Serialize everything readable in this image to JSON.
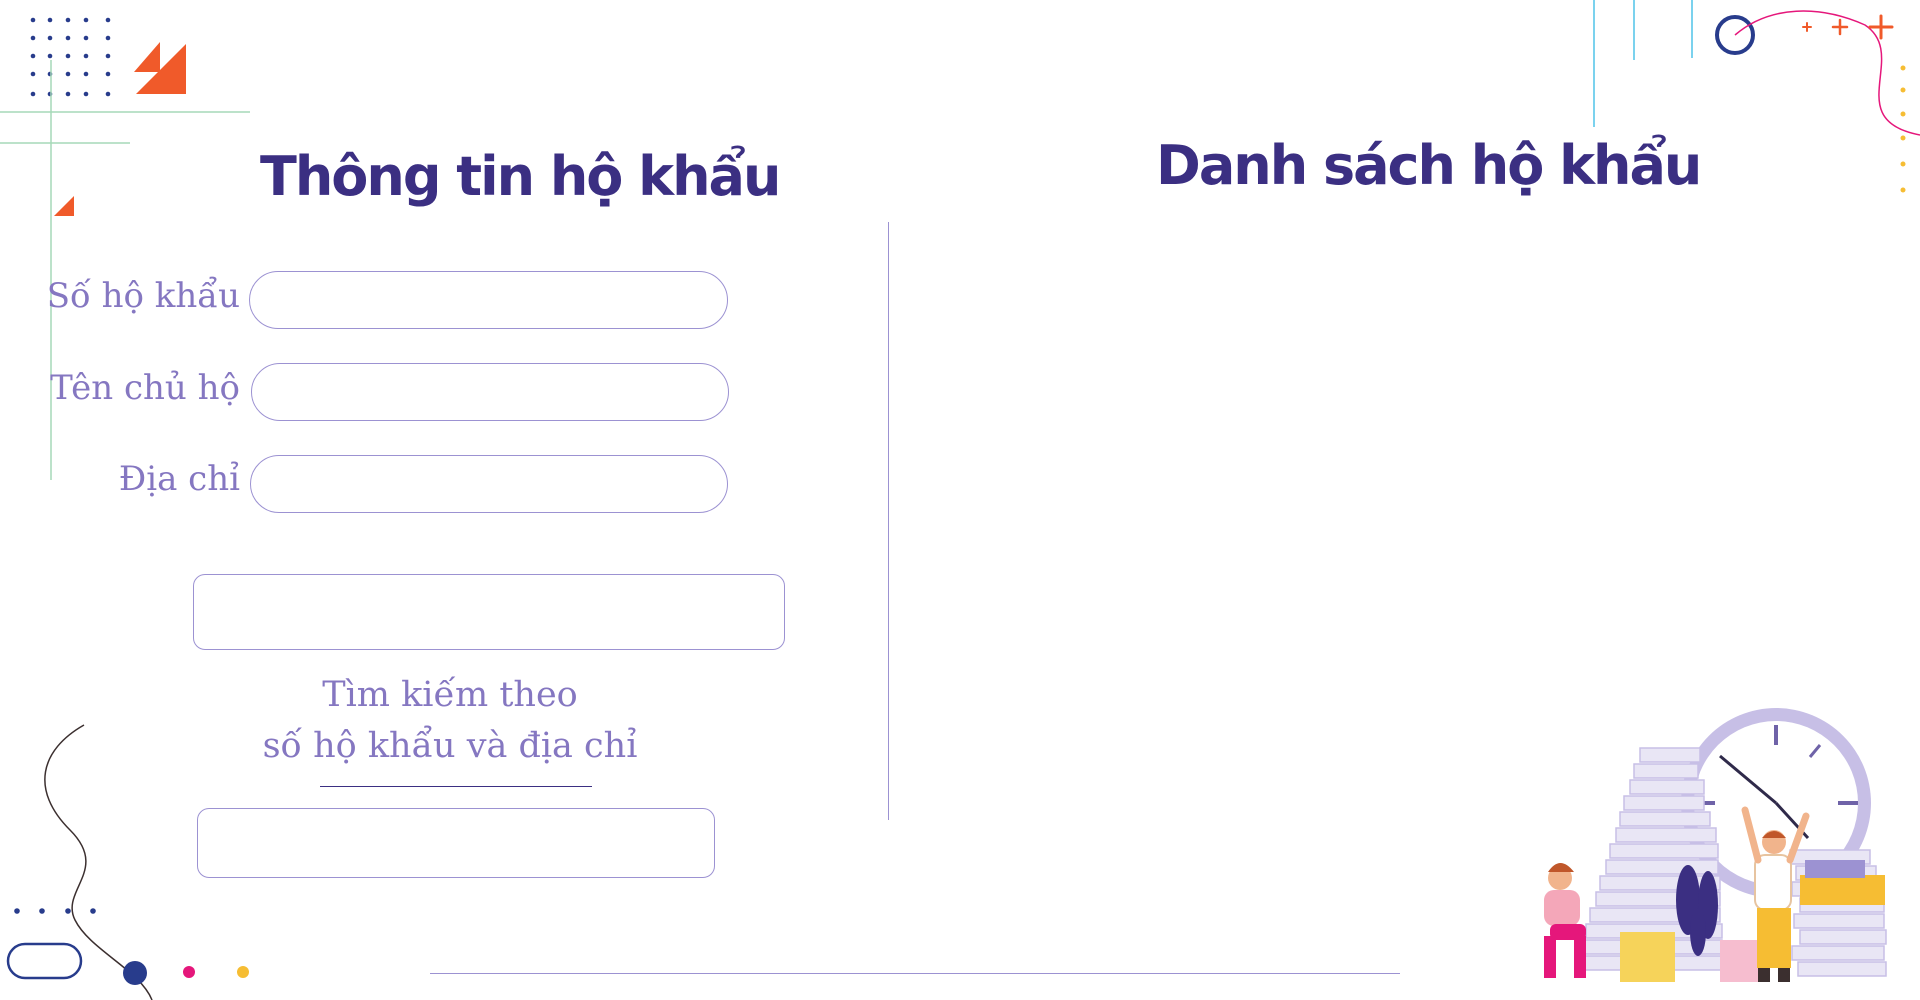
{
  "left_panel": {
    "title": "Thông tin hộ khẩu",
    "fields": [
      {
        "label": "Số hộ khẩu",
        "value": "",
        "placeholder": ""
      },
      {
        "label": "Tên chủ hộ",
        "value": "",
        "placeholder": ""
      },
      {
        "label": "Địa chỉ",
        "value": "",
        "placeholder": ""
      }
    ],
    "primary_button_label": "",
    "search": {
      "caption_line1": "Tìm kiếm theo",
      "caption_line2": "số hộ khẩu và địa chỉ",
      "input_value": "",
      "input_placeholder": ""
    }
  },
  "right_panel": {
    "title": "Danh sách hộ khẩu",
    "rows": []
  },
  "colors": {
    "title": "#3b2f82",
    "label": "#8577c1",
    "border": "#9c92d2",
    "accent_orange": "#f05a2a",
    "accent_pink": "#e5177b",
    "accent_yellow": "#f6bd33",
    "accent_navy": "#283c8c",
    "accent_cyan": "#4fc3e8",
    "accent_green": "#a5d9b8"
  },
  "decorations": {
    "top_left": [
      "dot-grid-icon",
      "triangle-icon"
    ],
    "top_right": [
      "circle-icon",
      "plus-icon",
      "dot-column-icon"
    ],
    "bottom_left": [
      "squiggle-icon",
      "pill-icon",
      "dot-row-icon"
    ],
    "bottom_right": "paperwork-clock-illustration"
  }
}
